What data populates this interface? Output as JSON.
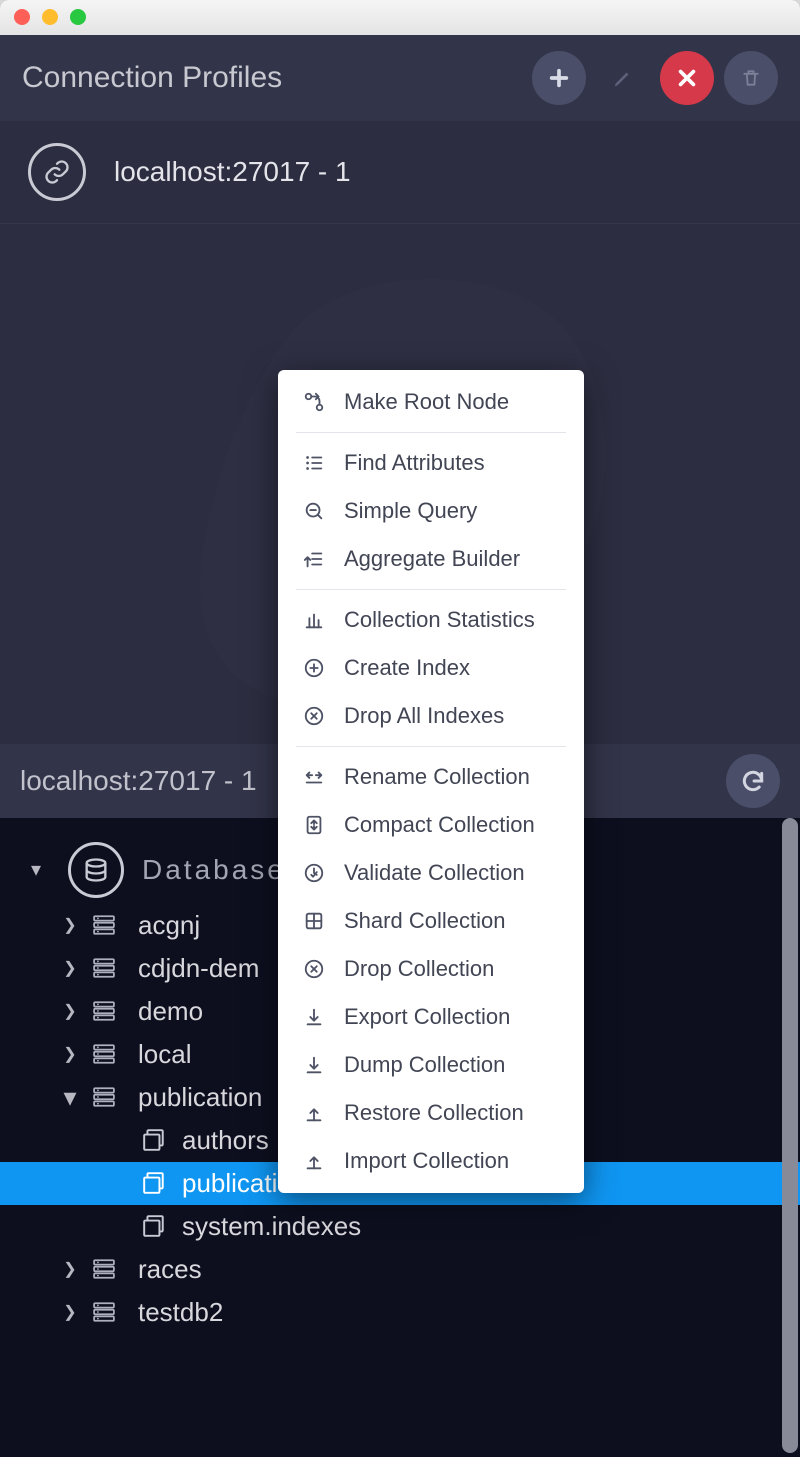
{
  "header": {
    "title": "Connection Profiles"
  },
  "connection": {
    "label": "localhost:27017 - 1"
  },
  "tree_header": {
    "label": "localhost:27017 - 1"
  },
  "tree": {
    "root_label": "Databases",
    "databases": [
      {
        "name": "acgnj",
        "expanded": false
      },
      {
        "name": "cdjdn-dem",
        "expanded": false
      },
      {
        "name": "demo",
        "expanded": false
      },
      {
        "name": "local",
        "expanded": false
      },
      {
        "name": "publication",
        "expanded": true,
        "collections": [
          {
            "name": "authors",
            "selected": false
          },
          {
            "name": "publications",
            "selected": true
          },
          {
            "name": "system.indexes",
            "selected": false
          }
        ]
      },
      {
        "name": "races",
        "expanded": false
      },
      {
        "name": "testdb2",
        "expanded": false
      }
    ]
  },
  "ctx": {
    "items": [
      {
        "icon": "branch",
        "label": "Make Root Node"
      },
      {
        "sep": true
      },
      {
        "icon": "list",
        "label": "Find Attributes"
      },
      {
        "icon": "search",
        "label": "Simple Query"
      },
      {
        "icon": "aggregate",
        "label": "Aggregate Builder"
      },
      {
        "sep": true
      },
      {
        "icon": "chartbar",
        "label": "Collection Statistics"
      },
      {
        "icon": "plus-circle",
        "label": "Create Index"
      },
      {
        "icon": "x-circle",
        "label": "Drop All Indexes"
      },
      {
        "sep": true
      },
      {
        "icon": "rename",
        "label": "Rename Collection"
      },
      {
        "icon": "compact",
        "label": "Compact Collection"
      },
      {
        "icon": "validate",
        "label": "Validate Collection"
      },
      {
        "icon": "shard",
        "label": "Shard Collection"
      },
      {
        "icon": "x-circle",
        "label": "Drop Collection"
      },
      {
        "icon": "download",
        "label": "Export Collection"
      },
      {
        "icon": "download",
        "label": "Dump Collection"
      },
      {
        "icon": "upload",
        "label": "Restore Collection"
      },
      {
        "icon": "upload",
        "label": "Import Collection"
      }
    ]
  }
}
